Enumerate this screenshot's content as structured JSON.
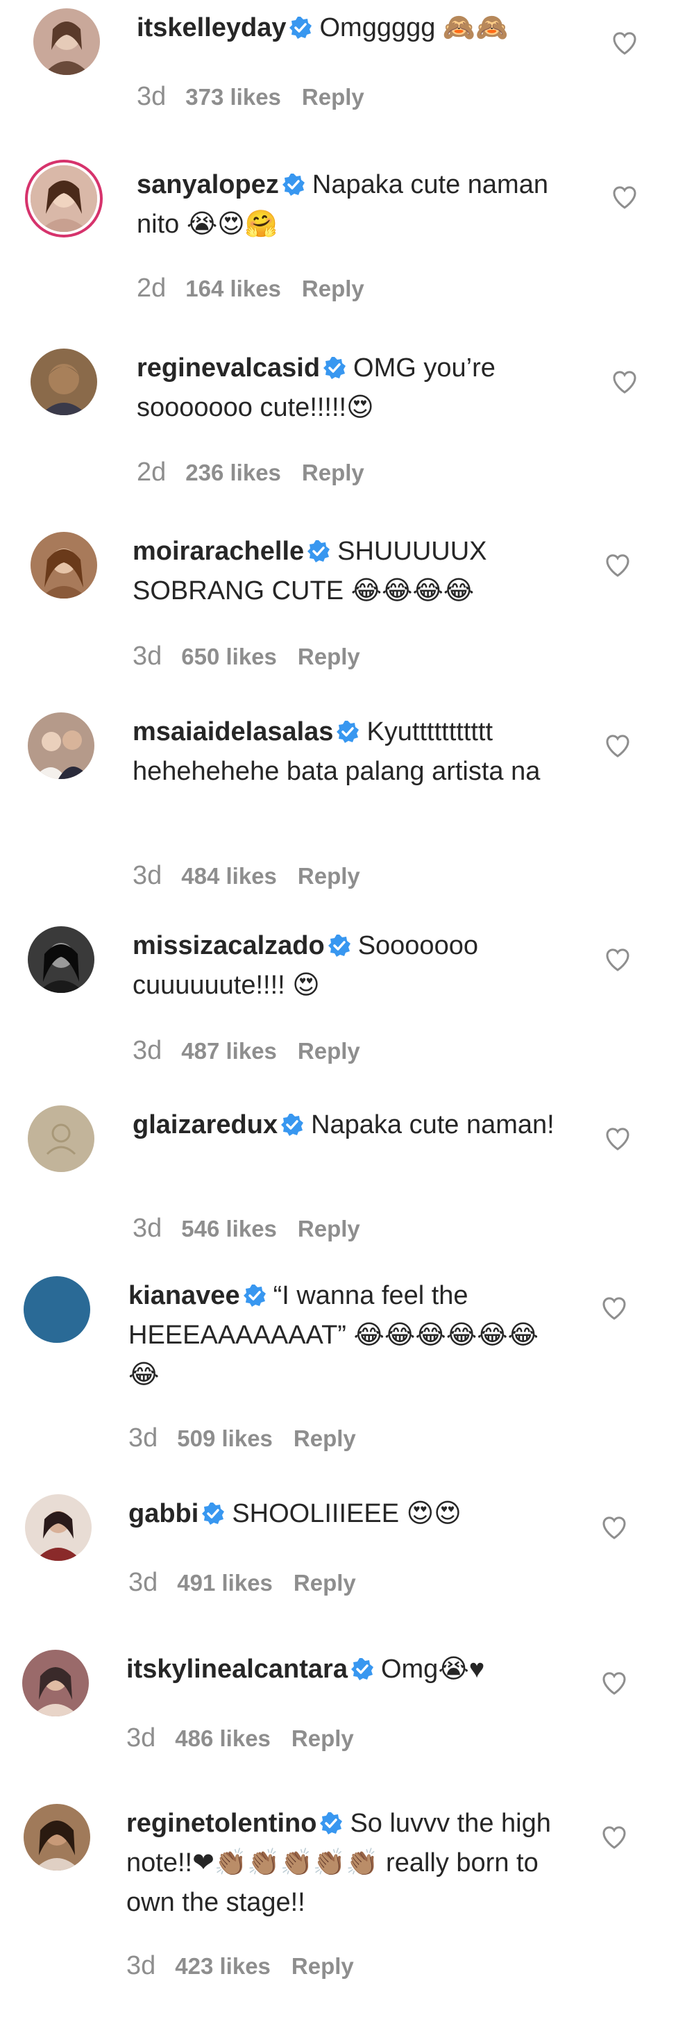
{
  "comments": [
    {
      "username": "itskelleyday",
      "text": "Omggggg 🙈🙈",
      "age": "3d",
      "likes": "373 likes",
      "reply": "Reply",
      "avatar_color": "#c9a89a",
      "story_ring": false
    },
    {
      "username": "sanyalopez",
      "text": "Napaka cute naman nito 😭😍🤗",
      "age": "2d",
      "likes": "164 likes",
      "reply": "Reply",
      "avatar_color": "#d9b8a8",
      "story_ring": true
    },
    {
      "username": "reginevalcasid",
      "text": "OMG you’re sooooooo cute!!!!!😍",
      "age": "2d",
      "likes": "236 likes",
      "reply": "Reply",
      "avatar_color": "#8a6a4a",
      "story_ring": false
    },
    {
      "username": "moirarachelle",
      "text": "SHUUUUUX SOBRANG CUTE 😂😂😂😂",
      "age": "3d",
      "likes": "650 likes",
      "reply": "Reply",
      "avatar_color": "#a87a5a",
      "story_ring": false
    },
    {
      "username": "msaiaidelasalas",
      "text": "Kyuttttttttttt hehehehehe bata palang artista na",
      "age": "3d",
      "likes": "484 likes",
      "reply": "Reply",
      "avatar_color": "#b59a8a",
      "story_ring": false
    },
    {
      "username": "missizacalzado",
      "text": "Sooooooo cuuuuuute!!!! 😍",
      "age": "3d",
      "likes": "487 likes",
      "reply": "Reply",
      "avatar_color": "#3a3a3a",
      "story_ring": false
    },
    {
      "username": "glaizaredux",
      "text": "Napaka cute naman!",
      "age": "3d",
      "likes": "546 likes",
      "reply": "Reply",
      "avatar_color": "#c2b49a",
      "story_ring": false
    },
    {
      "username": "kianavee",
      "text": "“I wanna feel the HEEEAAAAAAAT” 😂😂😂😂😂😂😂",
      "age": "3d",
      "likes": "509 likes",
      "reply": "Reply",
      "avatar_color": "#2a6a96",
      "story_ring": false
    },
    {
      "username": "gabbi",
      "text": "SHOOLIIIEEE 😍😍",
      "age": "3d",
      "likes": "491 likes",
      "reply": "Reply",
      "avatar_color": "#8a3a3a",
      "story_ring": false
    },
    {
      "username": "itskylinealcantara",
      "text": "Omg😭♥",
      "age": "3d",
      "likes": "486 likes",
      "reply": "Reply",
      "avatar_color": "#9a6a6a",
      "story_ring": false
    },
    {
      "username": "reginetolentino",
      "text": "So luvvv the high note!!❤👏🏽👏🏽👏🏽👏🏽👏🏽 really born to own the stage!!",
      "age": "3d",
      "likes": "423 likes",
      "reply": "Reply",
      "avatar_color": "#a07a5a",
      "story_ring": false
    }
  ],
  "colors": {
    "text": "#262626",
    "meta": "#8e8e8e",
    "verified": "#3897f0",
    "heart_outline": "#8e8e8e"
  },
  "icons": {
    "verified": "verified-badge-icon",
    "heart": "heart-outline-icon"
  }
}
